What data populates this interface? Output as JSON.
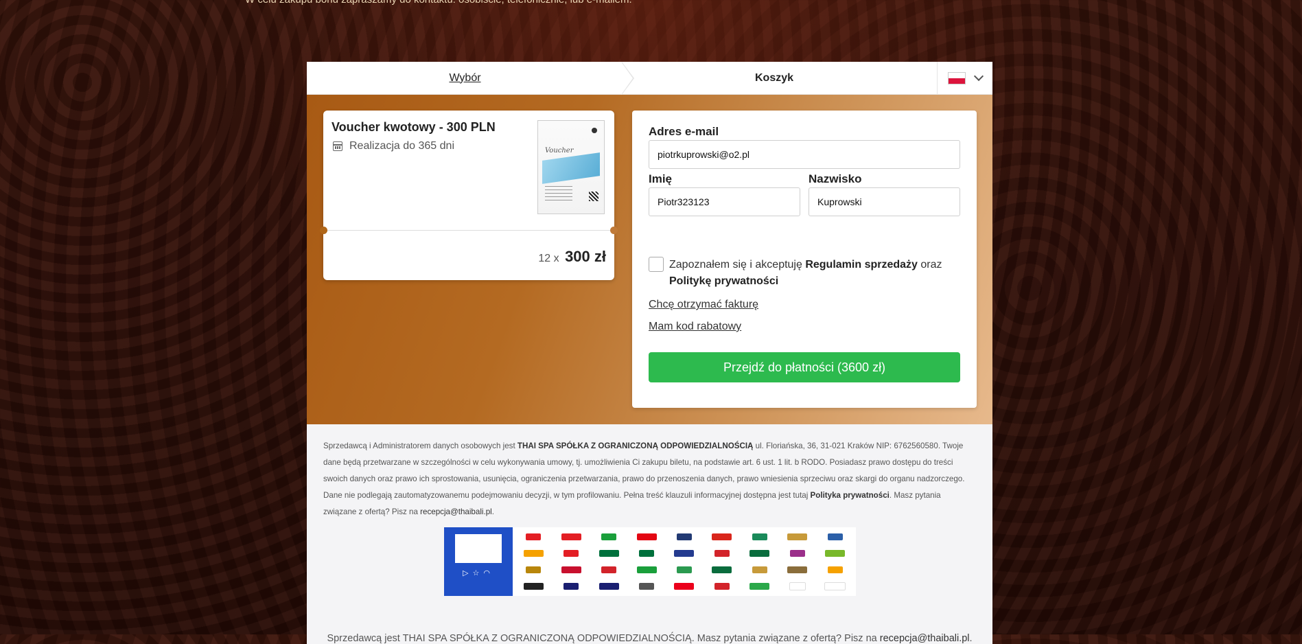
{
  "top_note": "W celu zakupu bonu zapraszamy do kontaktu: osobiście, telefonicznie, lub e-mailem.",
  "steps": {
    "wybor": "Wybór",
    "koszyk": "Koszyk"
  },
  "language": {
    "flag": "pl-flag-icon"
  },
  "voucher": {
    "title": "Voucher kwotowy - 300 PLN",
    "subtitle": "Realizacja do 365 dni",
    "thumb_word": "Voucher",
    "quantity": "12 x",
    "price": "300 zł"
  },
  "form": {
    "email_label": "Adres e-mail",
    "email_value": "piotrkuprowski@o2.pl",
    "first_name_label": "Imię",
    "first_name_value": "Piotr323123",
    "last_name_label": "Nazwisko",
    "last_name_value": "Kuprowski",
    "terms_prefix": "Zapoznałem się i akceptuję ",
    "terms_link": "Regulamin sprzedaży",
    "terms_mid": " oraz ",
    "privacy_link": "Politykę prywatności",
    "invoice_link": "Chcę otrzymać fakturę",
    "discount_link": "Mam kod rabatowy",
    "pay_button": "Przejdź do płatności (3600 zł)"
  },
  "info": {
    "p1_a": "Sprzedawcą i Administratorem danych osobowych jest ",
    "p1_company": "THAI SPA SPÓŁKA Z OGRANICZONĄ ODPOWIEDZIALNOŚCIĄ",
    "p1_b": " ul. Floriańska, 36, 31-021 Kraków NIP: 6762560580. Twoje dane będą przetwarzane w szczególności w celu wykonywania umowy, tj. umożliwienia Ci zakupu biletu, na podstawie art. 6 ust. 1 lit. b RODO. Posiadasz prawo dostępu do treści swoich danych oraz prawo ich sprostowania, usunięcia, ograniczenia przetwarzania, prawo do przenoszenia danych, prawo wniesienia sprzeciwu oraz skargi do organu nadzorczego. Dane nie podlegają zautomatyzowanemu podejmowaniu decyzji, w tym profilowaniu. Pełna treść klauzuli informacyjnej dostępna jest tutaj ",
    "p1_policy": "Polityka prywatności",
    "p1_c": ". Masz pytania związane z ofertą? Pisz na ",
    "p1_email": "recepcja@thaibali.pl",
    "p1_d": ".",
    "footer_a": "Sprzedawcą jest THAI SPA SPÓŁKA Z OGRANICZONĄ ODPOWIEDZIALNOŚCIĄ. Masz pytania związane z ofertą? Pisz na ",
    "footer_email": "recepcja@thaibali.pl",
    "footer_b": "."
  },
  "payment_logos": {
    "provider_icon": "bluemedia-logo",
    "bank_logo_colors": [
      "#e31e24",
      "#e31e24",
      "#1a9f3b",
      "#e30613",
      "#223a73",
      "#d9261c",
      "#1a8a5a",
      "#c79a3a",
      "#2b5fa8",
      "#f5a100",
      "#e31e24",
      "#00703c",
      "#00703c",
      "#243b8f",
      "#d2232a",
      "#0a6c3d",
      "#9b2f8a",
      "#78b82a",
      "#b8860b",
      "#c8102e",
      "#d2232a",
      "#1a9f3b",
      "#2b9a50",
      "#0a6c3d",
      "#c79a3a",
      "#8a6d3b",
      "#f5a100",
      "#222222",
      "#1a1f71",
      "#1a1f71",
      "#555555",
      "#eb001b",
      "#d2232a",
      "#2ba84a",
      "#ffffff",
      "#ffffff"
    ]
  }
}
